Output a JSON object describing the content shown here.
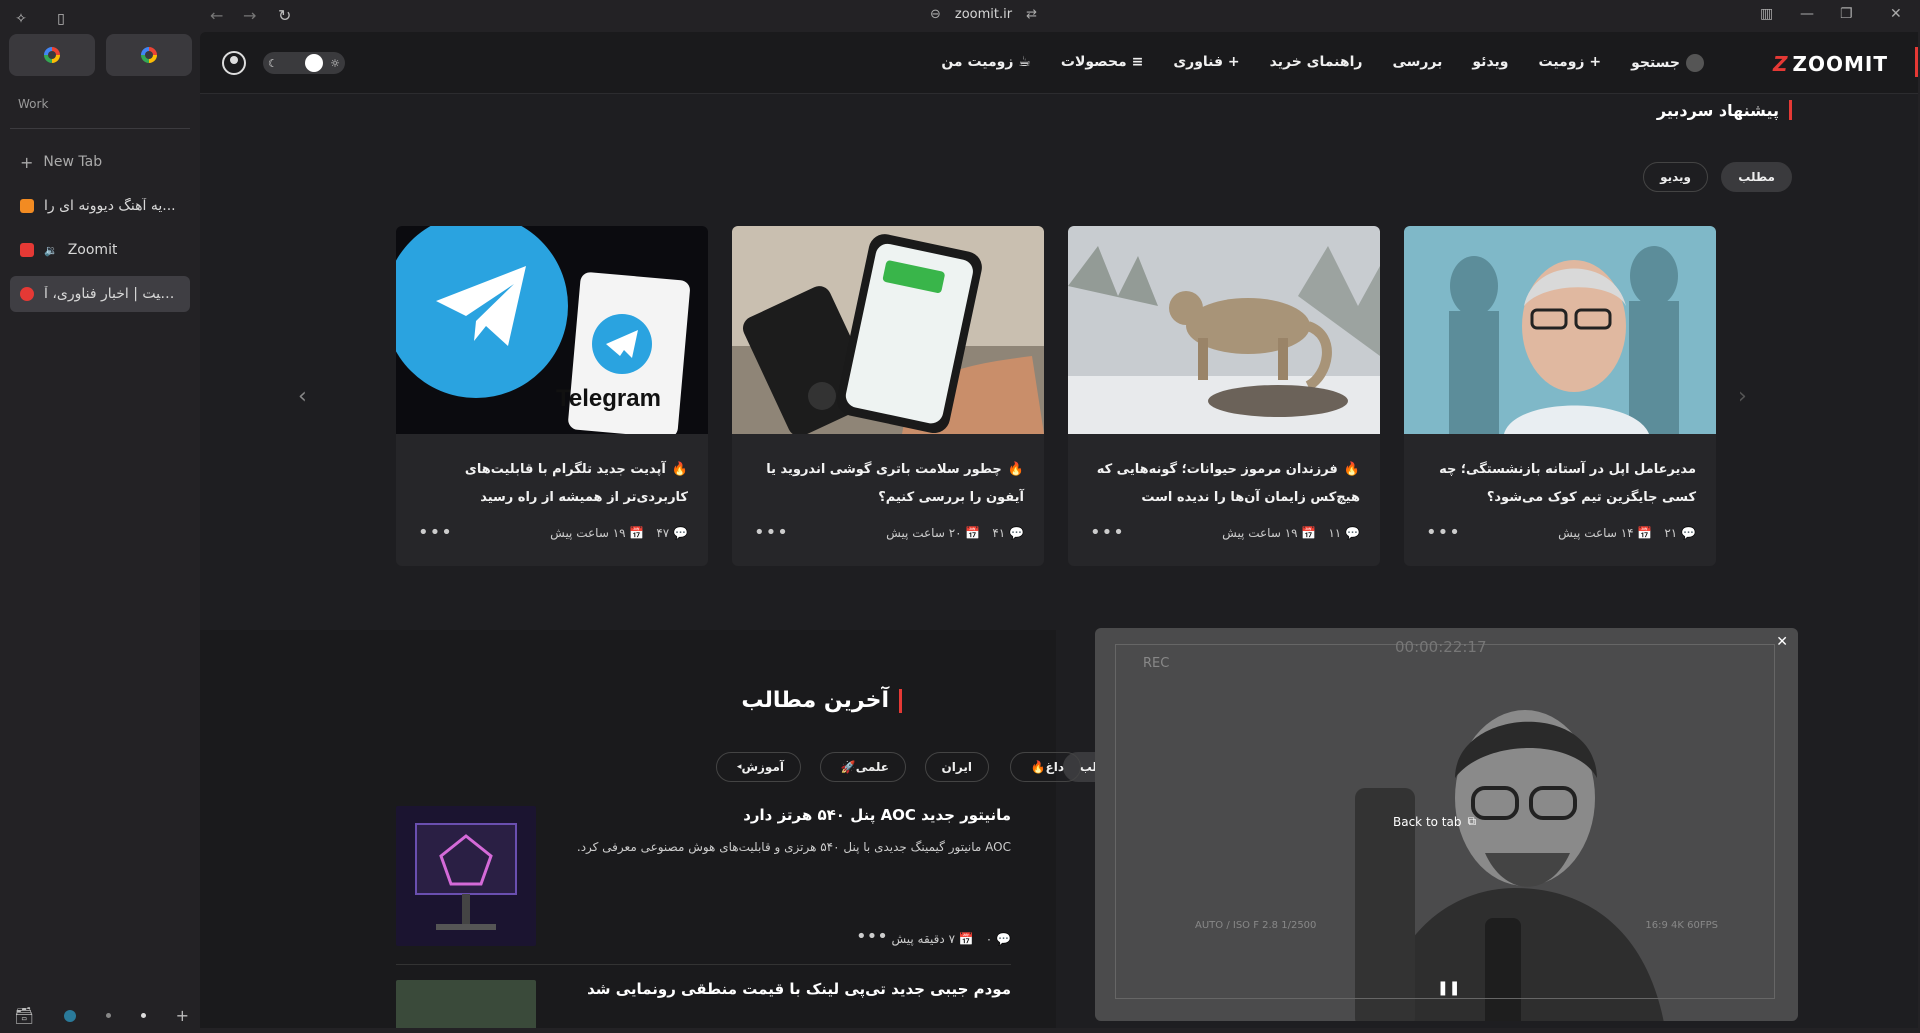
{
  "browser": {
    "url": "zoomit.ir",
    "workspace_label": "Work",
    "new_tab_label": "New Tab",
    "tabs": [
      {
        "label": "یه آهنگ دیوونه ای را...",
        "favicon_color": "#f28b22"
      },
      {
        "label": "Zoomit",
        "favicon_color": "#e53935",
        "audio": "🔉"
      },
      {
        "label": "زومیت | اخبار فناوری، آ...",
        "favicon_color": "#e53935"
      }
    ]
  },
  "site": {
    "logo": "ZOOMIT",
    "menu": [
      "زومیت من",
      "≡ محصولات",
      "+ فناوری",
      "راهنمای خرید",
      "بررسی",
      "ویدئو",
      "+ زومیت",
      "جستجو"
    ]
  },
  "editor_pick": {
    "title": "پیشنهاد سردبیر",
    "filters": [
      "مطلب",
      "ویدیو"
    ],
    "cards": [
      {
        "title": "مدیرعامل اپل در آستانه بازنشستگی؛ چه کسی جایگزین تیم کوک می‌شود؟",
        "comments": "۲۱",
        "time": "۱۴ ساعت پیش",
        "hot": false
      },
      {
        "title": "فرزندان مرموز حیوانات؛ گونه‌هایی که هیچ‌کس زایمان آن‌ها را ندیده است",
        "comments": "۱۱",
        "time": "۱۹ ساعت پیش",
        "hot": true
      },
      {
        "title": "چطور سلامت باتری گوشی اندروید یا آیفون را بررسی کنیم؟",
        "comments": "۴۱",
        "time": "۲۰ ساعت پیش",
        "hot": true
      },
      {
        "title": "آپدیت جدید تلگرام با قابلیت‌های کاربردی‌تر از همیشه از راه رسید",
        "comments": "۴۷",
        "time": "۱۹ ساعت پیش",
        "hot": true
      }
    ]
  },
  "latest": {
    "title": "آخرین مطالب",
    "filters": [
      "جدیدترین مطالب",
      "داغ",
      "ایران",
      "علمی",
      "آموزش"
    ],
    "posts": [
      {
        "title": "مانیتور جدید AOC پنل ۵۴۰ هرتز دارد",
        "desc": "AOC مانیتور گیمینگ جدیدی با پنل ۵۴۰ هرتزی و قابلیت‌های هوش مصنوعی معرفی کرد.",
        "comments": "۰",
        "time": "۷ دقیقه پیش"
      },
      {
        "title": "مودم جیبی جدید تی‌پی لینک با قیمت منطقی رونمایی شد",
        "desc": "",
        "comments": "",
        "time": ""
      }
    ]
  },
  "pip": {
    "rec": "REC",
    "timecode": "00:00:22:17",
    "back_label": "Back to tab",
    "camera_info": "AUTO / ISO   F 2.8  1/2500",
    "fps_info": "16:9  4K  60FPS"
  }
}
